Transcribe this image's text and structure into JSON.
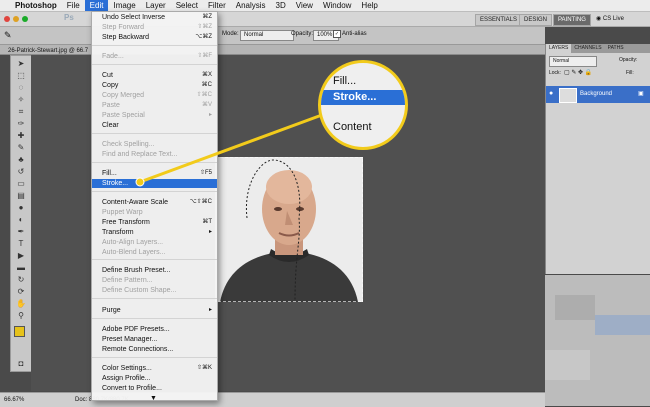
{
  "menubar": {
    "apple": "",
    "items": [
      "Photoshop",
      "File",
      "Edit",
      "Image",
      "Layer",
      "Select",
      "Filter",
      "Analysis",
      "3D",
      "View",
      "Window",
      "Help"
    ]
  },
  "appbar": {
    "ps_logo": "Ps",
    "workspaces": [
      "ESSENTIALS",
      "DESIGN",
      "PAINTING"
    ],
    "cslive": "CS Live"
  },
  "options": {
    "mode_label": "Mode:",
    "mode_value": "Normal",
    "opacity_label": "Opacity:",
    "opacity_value": "100%",
    "antialias": "Anti-alias"
  },
  "document": {
    "tab": "26-Patrick-Stewart.jpg @ 66.7",
    "zoom": "66.67%",
    "doc_info": "Doc: 880.7K/880.7K"
  },
  "panel": {
    "tabs": [
      "LAYERS",
      "CHANNELS",
      "PATHS"
    ],
    "blend_mode": "Normal",
    "opacity_label": "Opacity:",
    "lock_label": "Lock:",
    "fill_label": "Fill:",
    "layer_name": "Background"
  },
  "edit_menu": [
    {
      "label": "Undo Select Inverse",
      "shortcut": "⌘Z",
      "disabled": false
    },
    {
      "label": "Step Forward",
      "shortcut": "⇧⌘Z",
      "disabled": true
    },
    {
      "label": "Step Backward",
      "shortcut": "⌥⌘Z",
      "disabled": false
    },
    {
      "label": "Fade...",
      "shortcut": "⇧⌘F",
      "disabled": true
    },
    {
      "label": "Cut",
      "shortcut": "⌘X",
      "disabled": false
    },
    {
      "label": "Copy",
      "shortcut": "⌘C",
      "disabled": false
    },
    {
      "label": "Copy Merged",
      "shortcut": "⇧⌘C",
      "disabled": true
    },
    {
      "label": "Paste",
      "shortcut": "⌘V",
      "disabled": true
    },
    {
      "label": "Paste Special",
      "shortcut": "▸",
      "disabled": true
    },
    {
      "label": "Clear",
      "shortcut": "",
      "disabled": false
    },
    {
      "label": "Check Spelling...",
      "shortcut": "",
      "disabled": true
    },
    {
      "label": "Find and Replace Text...",
      "shortcut": "",
      "disabled": true
    },
    {
      "label": "Fill...",
      "shortcut": "⇧F5",
      "disabled": false
    },
    {
      "label": "Stroke...",
      "shortcut": "",
      "disabled": false,
      "highlighted": true
    },
    {
      "label": "Content-Aware Scale",
      "shortcut": "⌥⇧⌘C",
      "disabled": false
    },
    {
      "label": "Puppet Warp",
      "shortcut": "",
      "disabled": true
    },
    {
      "label": "Free Transform",
      "shortcut": "⌘T",
      "disabled": false
    },
    {
      "label": "Transform",
      "shortcut": "▸",
      "disabled": false
    },
    {
      "label": "Auto-Align Layers...",
      "shortcut": "",
      "disabled": true
    },
    {
      "label": "Auto-Blend Layers...",
      "shortcut": "",
      "disabled": true
    },
    {
      "label": "Define Brush Preset...",
      "shortcut": "",
      "disabled": false
    },
    {
      "label": "Define Pattern...",
      "shortcut": "",
      "disabled": true
    },
    {
      "label": "Define Custom Shape...",
      "shortcut": "",
      "disabled": true
    },
    {
      "label": "Purge",
      "shortcut": "▸",
      "disabled": false
    },
    {
      "label": "Adobe PDF Presets...",
      "shortcut": "",
      "disabled": false
    },
    {
      "label": "Preset Manager...",
      "shortcut": "",
      "disabled": false
    },
    {
      "label": "Remote Connections...",
      "shortcut": "",
      "disabled": false
    },
    {
      "label": "Color Settings...",
      "shortcut": "⇧⌘K",
      "disabled": false
    },
    {
      "label": "Assign Profile...",
      "shortcut": "",
      "disabled": false
    },
    {
      "label": "Convert to Profile...",
      "shortcut": "",
      "disabled": false
    },
    {
      "label": "▼",
      "shortcut": "",
      "disabled": false
    }
  ],
  "magnifier": {
    "items": [
      "Fill...",
      "Stroke...",
      "Content"
    ]
  },
  "colors": {
    "highlight": "#2a6fd6",
    "callout": "#f2cb1b"
  }
}
